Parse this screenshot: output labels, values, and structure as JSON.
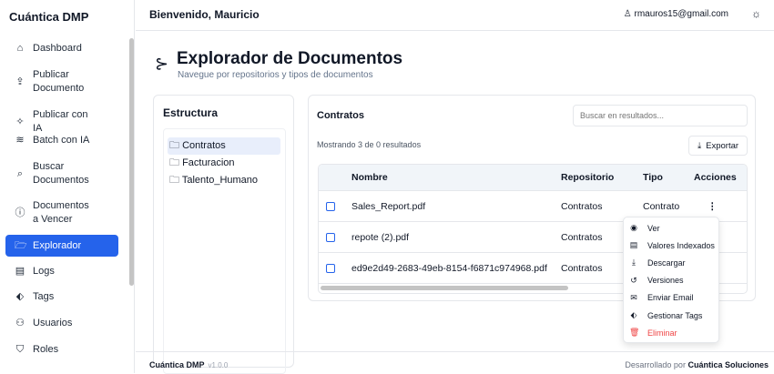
{
  "sidebar": {
    "brand": "Cuántica DMP",
    "items": [
      {
        "label": "Dashboard",
        "icon": "home-icon",
        "glyph": "⌂"
      },
      {
        "label": "Publicar Documento",
        "icon": "upload-icon",
        "glyph": "⇪"
      },
      {
        "label": "Publicar con IA",
        "icon": "sparkles-icon",
        "glyph": "✧"
      },
      {
        "label": "Batch con IA",
        "icon": "layers-icon",
        "glyph": "≋"
      },
      {
        "label": "Buscar Documentos",
        "icon": "search-icon",
        "glyph": "⌕"
      },
      {
        "label": "Documentos a Vencer",
        "icon": "alert-circle-icon",
        "glyph": "ⓘ"
      },
      {
        "label": "Explorador",
        "icon": "folder-open-icon",
        "glyph": "🗁"
      },
      {
        "label": "Logs",
        "icon": "scroll-icon",
        "glyph": "▤"
      },
      {
        "label": "Tags",
        "icon": "tag-icon",
        "glyph": "⬖"
      },
      {
        "label": "Usuarios",
        "icon": "users-icon",
        "glyph": "⚇"
      },
      {
        "label": "Roles",
        "icon": "shield-icon",
        "glyph": "⛉"
      }
    ]
  },
  "header": {
    "welcome": "Bienvenido, Mauricio",
    "user_email": "rmauros15@gmail.com",
    "user_glyph": "♙",
    "theme_glyph": "☼"
  },
  "page": {
    "title": "Explorador de Documentos",
    "subtitle": "Navegue por repositorios y tipos de documentos",
    "icon_glyph": "⊱"
  },
  "structure": {
    "title": "Estructura",
    "folders": [
      "Contratos",
      "Facturacion",
      "Talento_Humano"
    ],
    "selected": "Contratos",
    "folder_glyph": "🗀"
  },
  "results": {
    "title": "Contratos",
    "search_placeholder": "Buscar en resultados...",
    "showing": "Mostrando 3 de 0 resultados",
    "export_label": "Exportar",
    "export_glyph": "⤓",
    "columns": [
      "Nombre",
      "Repositorio",
      "Tipo",
      "Acciones"
    ],
    "rows": [
      {
        "name": "Sales_Report.pdf",
        "repo": "Contratos",
        "type": "Contrato"
      },
      {
        "name": "repote (2).pdf",
        "repo": "Contratos",
        "type": ""
      },
      {
        "name": "ed9e2d49-2683-49eb-8154-f6871c974968.pdf",
        "repo": "Contratos",
        "type": ""
      }
    ],
    "actions_glyph": "⋮"
  },
  "menu": {
    "items": [
      {
        "label": "Ver",
        "glyph": "◉",
        "icon": "eye-icon"
      },
      {
        "label": "Valores Indexados",
        "glyph": "▤",
        "icon": "file-text-icon"
      },
      {
        "label": "Descargar",
        "glyph": "⤓",
        "icon": "download-icon"
      },
      {
        "label": "Versiones",
        "glyph": "↺",
        "icon": "history-icon"
      },
      {
        "label": "Enviar Email",
        "glyph": "✉",
        "icon": "mail-icon"
      },
      {
        "label": "Gestionar Tags",
        "glyph": "⬖",
        "icon": "tag-icon"
      },
      {
        "label": "Eliminar",
        "glyph": "🗑",
        "icon": "trash-icon"
      }
    ],
    "danger_color": "#ef4444"
  },
  "footer": {
    "brand": "Cuántica DMP",
    "version": "v1.0.0",
    "developed_by": "Desarrollado por",
    "company": "Cuántica Soluciones"
  },
  "colors": {
    "accent": "#2563eb"
  }
}
